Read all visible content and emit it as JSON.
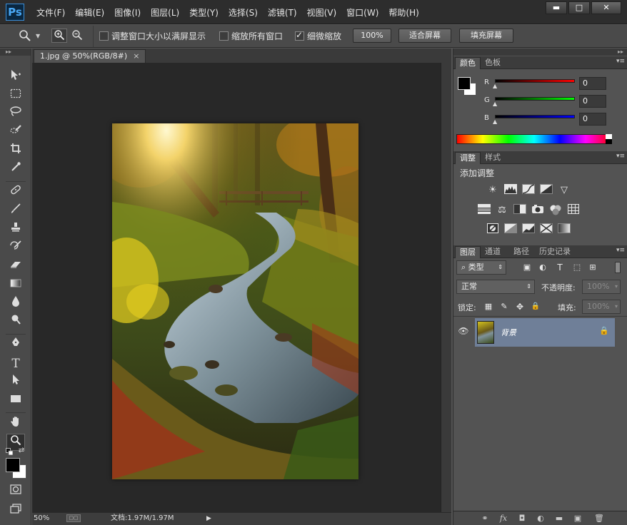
{
  "app": {
    "logo": "Ps"
  },
  "menu": [
    "文件(F)",
    "编辑(E)",
    "图像(I)",
    "图层(L)",
    "类型(Y)",
    "选择(S)",
    "滤镜(T)",
    "视图(V)",
    "窗口(W)",
    "帮助(H)"
  ],
  "window_controls": {
    "minimize": "▬",
    "maximize": "□",
    "close": "✕"
  },
  "options": {
    "resize_windows_label": "调整窗口大小以满屏显示",
    "zoom_all_label": "缩放所有窗口",
    "scrubby_zoom_label": "细微缩放",
    "zoom_100": "100%",
    "fit_screen": "适合屏幕",
    "fill_screen": "填充屏幕"
  },
  "document": {
    "tab_title": "1.jpg @ 50%(RGB/8#)",
    "close": "×"
  },
  "status": {
    "zoom": "50%",
    "doc_info": "文档:1.97M/1.97M"
  },
  "color_panel": {
    "tabs": [
      "颜色",
      "色板"
    ],
    "channels": [
      {
        "label": "R",
        "value": "0"
      },
      {
        "label": "G",
        "value": "0"
      },
      {
        "label": "B",
        "value": "0"
      }
    ]
  },
  "adjust_panel": {
    "tabs": [
      "调整",
      "样式"
    ],
    "title": "添加调整"
  },
  "layers_panel": {
    "tabs": [
      "图层",
      "通道",
      "路径",
      "历史记录"
    ],
    "filter_label": "类型",
    "blend_mode": "正常",
    "opacity_label": "不透明度:",
    "opacity_value": "100%",
    "lock_label": "锁定:",
    "fill_label": "填充:",
    "fill_value": "100%",
    "layers": [
      {
        "name": "背景"
      }
    ]
  },
  "colors": {
    "accent": "#3b8ed8",
    "layer_selected": "#6f7f98",
    "panel_bg": "#535353",
    "canvas_bg": "#282828"
  }
}
